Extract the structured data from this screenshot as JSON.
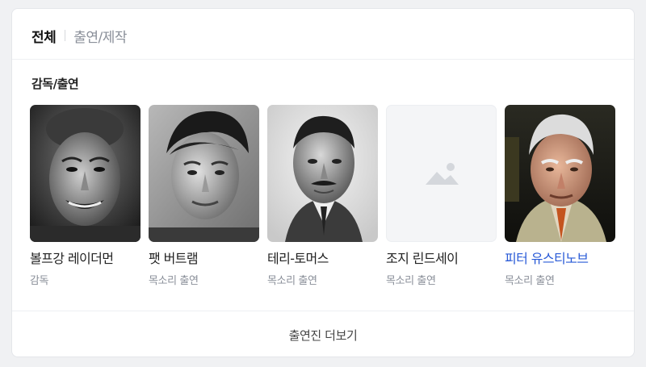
{
  "tabs": [
    {
      "label": "전체",
      "active": true
    },
    {
      "label": "출연/제작",
      "active": false
    }
  ],
  "section": {
    "title": "감독/출연"
  },
  "people": [
    {
      "name": "볼프강 레이더먼",
      "role": "감독",
      "photo": "bw-elderly-man-photo",
      "name_color": "#222222"
    },
    {
      "name": "팻 버트램",
      "role": "목소리 출연",
      "photo": "bw-young-man-photo",
      "name_color": "#222222"
    },
    {
      "name": "테리-토머스",
      "role": "목소리 출연",
      "photo": "bw-mustached-man-photo",
      "name_color": "#222222"
    },
    {
      "name": "조지 린드세이",
      "role": "목소리 출연",
      "photo": "image-placeholder-icon",
      "name_color": "#222222"
    },
    {
      "name": "피터 유스티노브",
      "role": "목소리 출연",
      "photo": "color-elderly-man-photo",
      "name_color": "#2a5bd7"
    }
  ],
  "footer": {
    "more_label": "출연진 더보기"
  },
  "colors": {
    "link": "#2a5bd7",
    "muted": "#8a8f99",
    "background": "#f0f1f3"
  }
}
